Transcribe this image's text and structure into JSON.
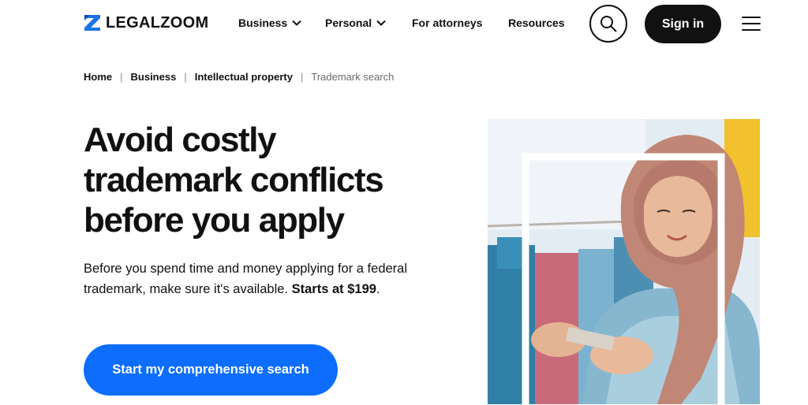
{
  "brand": {
    "name": "LEGALZOOM",
    "accent": "#0d6efd",
    "logo_color": "#1a73e8"
  },
  "nav": {
    "items": [
      {
        "label": "Business",
        "has_dropdown": true
      },
      {
        "label": "Personal",
        "has_dropdown": true
      },
      {
        "label": "For attorneys",
        "has_dropdown": false
      },
      {
        "label": "Resources",
        "has_dropdown": false
      }
    ],
    "search_icon": "search-icon",
    "signin_label": "Sign in",
    "menu_icon": "hamburger-menu-icon"
  },
  "breadcrumb": {
    "items": [
      "Home",
      "Business",
      "Intellectual property"
    ],
    "current": "Trademark search",
    "separator": "|"
  },
  "hero": {
    "title_lines": [
      "Avoid costly",
      "trademark conflicts",
      "before you apply"
    ],
    "description": "Before you spend time and money applying for a federal trademark, make sure it's available.",
    "price_prefix": "Starts at",
    "price": "$199",
    "price_suffix": ".",
    "cta_label": "Start my comprehensive search"
  },
  "colors": {
    "text": "#111111",
    "muted": "#6b6b6b",
    "cta": "#0d6efd",
    "photo_accent": "#f2c12e"
  }
}
